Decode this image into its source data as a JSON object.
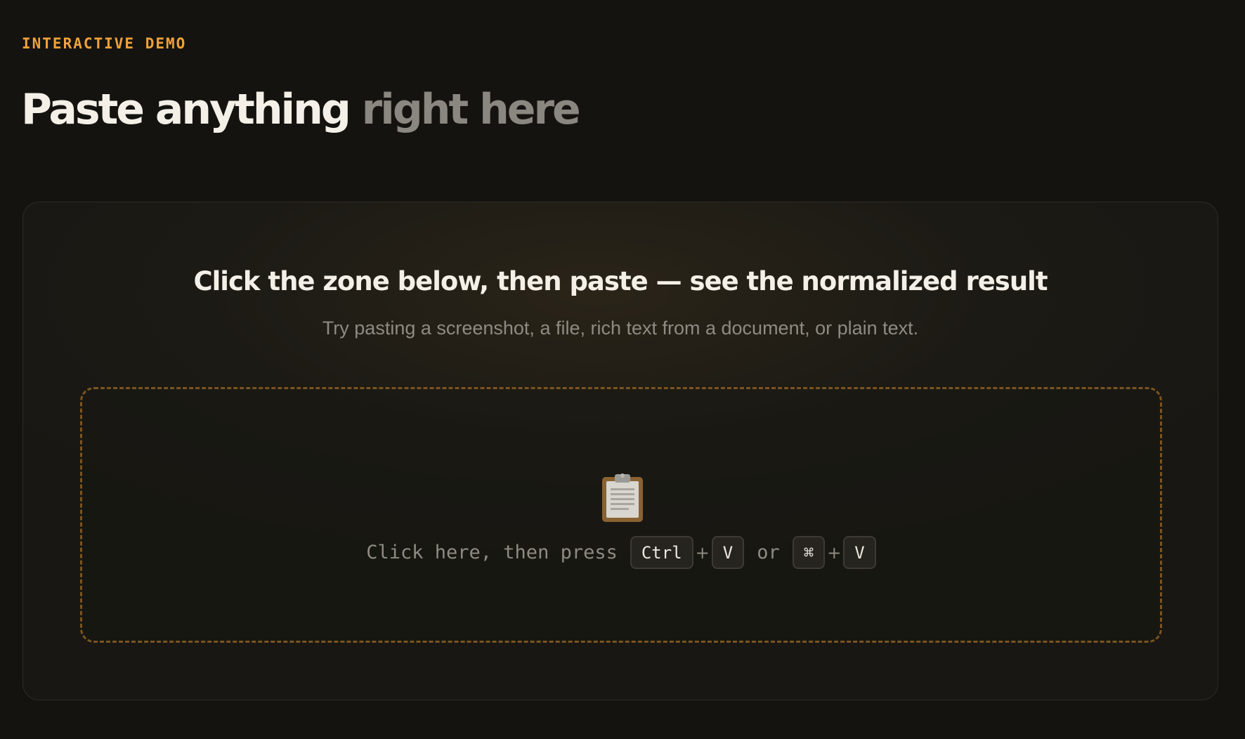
{
  "header": {
    "eyebrow": "INTERACTIVE DEMO",
    "title_main": "Paste anything",
    "title_muted": "right here"
  },
  "card": {
    "title": "Click the zone below, then paste — see the normalized result",
    "subtitle": "Try pasting a screenshot, a file, rich text from a document, or plain text."
  },
  "dropzone": {
    "icon": "clipboard-icon",
    "prompt": "Click here, then press",
    "shortcut_windows": {
      "modifier": "Ctrl",
      "key": "V"
    },
    "separator": "or",
    "shortcut_mac": {
      "modifier": "⌘",
      "key": "V"
    },
    "plus": "+"
  },
  "colors": {
    "background": "#141310",
    "accent": "#f0a23a",
    "dashed_border": "#7a5420",
    "muted_text": "#8f8a82"
  }
}
